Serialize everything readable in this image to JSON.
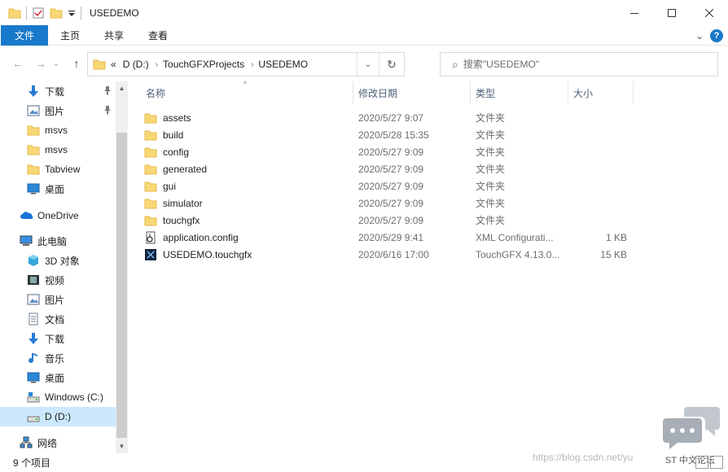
{
  "window": {
    "title": "USEDEMO",
    "controls": [
      "minimize-icon",
      "maximize-icon",
      "close-icon"
    ]
  },
  "ribbon": {
    "file_tab": "文件",
    "tabs": [
      "主页",
      "共享",
      "查看"
    ],
    "expand_glyph": "⌄",
    "help_glyph": "?"
  },
  "address": {
    "back_glyph": "←",
    "forward_glyph": "→",
    "history_glyph": "⌄",
    "up_glyph": "↑",
    "overflow": "«",
    "crumbs": [
      "D (D:)",
      "TouchGFXProjects",
      "USEDEMO"
    ],
    "crumb_separator": "›",
    "dropdown_glyph": "⌄",
    "refresh_glyph": "↻"
  },
  "search": {
    "placeholder": "搜索\"USEDEMO\"",
    "icon_glyph": "⌕"
  },
  "nav": {
    "pin_glyph": "📌",
    "scroll_up_glyph": "▲",
    "scroll_down_glyph": "▼",
    "items": [
      {
        "label": "下载",
        "icon": "download-icon",
        "pinned": true
      },
      {
        "label": "图片",
        "icon": "pictures-icon",
        "pinned": true
      },
      {
        "label": "msvs",
        "icon": "folder-icon",
        "pinned": false
      },
      {
        "label": "msvs",
        "icon": "folder-icon",
        "pinned": false
      },
      {
        "label": "Tabview",
        "icon": "folder-icon",
        "pinned": false
      },
      {
        "label": "桌面",
        "icon": "desktop-icon",
        "pinned": false
      },
      {
        "label": "OneDrive",
        "icon": "cloud-icon",
        "pinned": false
      },
      {
        "label": "此电脑",
        "icon": "computer-icon",
        "pinned": false
      },
      {
        "label": "3D 对象",
        "icon": "3d-objects-icon",
        "pinned": false
      },
      {
        "label": "视频",
        "icon": "video-icon",
        "pinned": false
      },
      {
        "label": "图片",
        "icon": "pictures-icon",
        "pinned": false
      },
      {
        "label": "文档",
        "icon": "documents-icon",
        "pinned": false
      },
      {
        "label": "下载",
        "icon": "download-icon",
        "pinned": false
      },
      {
        "label": "音乐",
        "icon": "music-icon",
        "pinned": false
      },
      {
        "label": "桌面",
        "icon": "desktop-icon",
        "pinned": false
      },
      {
        "label": "Windows (C:)",
        "icon": "drive-c-icon",
        "pinned": false
      },
      {
        "label": "D (D:)",
        "icon": "drive-d-icon",
        "pinned": false,
        "selected": true
      },
      {
        "label": "网络",
        "icon": "network-icon",
        "pinned": false
      }
    ]
  },
  "columns": {
    "name": "名称",
    "date": "修改日期",
    "type": "类型",
    "size": "大小",
    "sort_glyph": "^"
  },
  "files": [
    {
      "name": "assets",
      "date": "2020/5/27 9:07",
      "type": "文件夹",
      "size": "",
      "icon": "folder-icon"
    },
    {
      "name": "build",
      "date": "2020/5/28 15:35",
      "type": "文件夹",
      "size": "",
      "icon": "folder-icon"
    },
    {
      "name": "config",
      "date": "2020/5/27 9:09",
      "type": "文件夹",
      "size": "",
      "icon": "folder-icon"
    },
    {
      "name": "generated",
      "date": "2020/5/27 9:09",
      "type": "文件夹",
      "size": "",
      "icon": "folder-icon"
    },
    {
      "name": "gui",
      "date": "2020/5/27 9:09",
      "type": "文件夹",
      "size": "",
      "icon": "folder-icon"
    },
    {
      "name": "simulator",
      "date": "2020/5/27 9:09",
      "type": "文件夹",
      "size": "",
      "icon": "folder-icon"
    },
    {
      "name": "touchgfx",
      "date": "2020/5/27 9:09",
      "type": "文件夹",
      "size": "",
      "icon": "folder-icon"
    },
    {
      "name": "application.config",
      "date": "2020/5/29 9:41",
      "type": "XML Configurati...",
      "size": "1 KB",
      "icon": "config-file-icon"
    },
    {
      "name": "USEDEMO.touchgfx",
      "date": "2020/6/16 17:00",
      "type": "TouchGFX 4.13.0...",
      "size": "15 KB",
      "icon": "touchgfx-file-icon"
    }
  ],
  "status": {
    "item_count": "9 个项目",
    "watermark": "https://blog.csdn.net/yu",
    "chat_label": "ST 中文论坛"
  },
  "colors": {
    "accent": "#1979ca",
    "folder": "#f8d775",
    "folder_dark": "#e6b94a",
    "selected": "#cce8ff",
    "header_text": "#4c607a"
  }
}
